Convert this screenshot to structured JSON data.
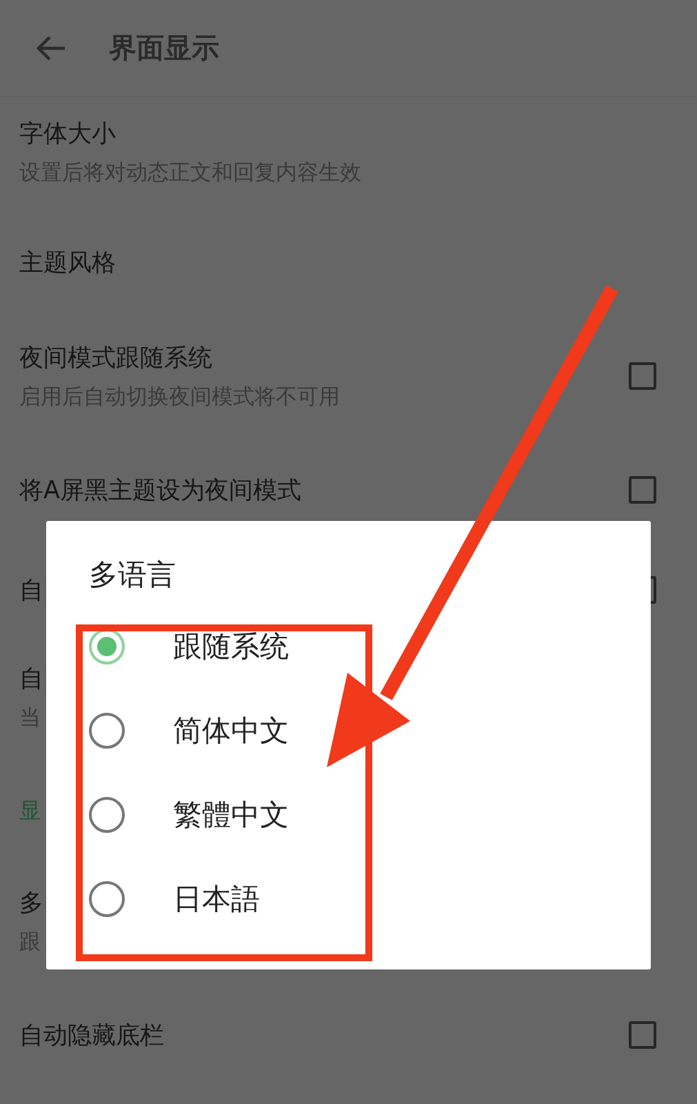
{
  "header": {
    "title": "界面显示"
  },
  "settings": [
    {
      "kind": "item",
      "title": "字体大小",
      "subtitle": "设置后将对动态正文和回复内容生效"
    },
    {
      "kind": "item",
      "title": "主题风格"
    },
    {
      "kind": "toggle",
      "title": "夜间模式跟随系统",
      "subtitle": "启用后自动切换夜间模式将不可用",
      "checked": false
    },
    {
      "kind": "toggle",
      "title": "将A屏黑主题设为夜间模式",
      "checked": false
    },
    {
      "kind": "toggle",
      "title": "自"
    },
    {
      "kind": "item",
      "title": "自",
      "subtitle": "当"
    },
    {
      "kind": "section",
      "title": "显"
    },
    {
      "kind": "item",
      "title": "多",
      "subtitle": "跟"
    },
    {
      "kind": "toggle",
      "title": "自动隐藏底栏",
      "checked": false
    }
  ],
  "dialog": {
    "title": "多语言",
    "options": [
      {
        "label": "跟随系统",
        "selected": true
      },
      {
        "label": "简体中文",
        "selected": false
      },
      {
        "label": "繁體中文",
        "selected": false
      },
      {
        "label": "日本語",
        "selected": false
      }
    ]
  }
}
